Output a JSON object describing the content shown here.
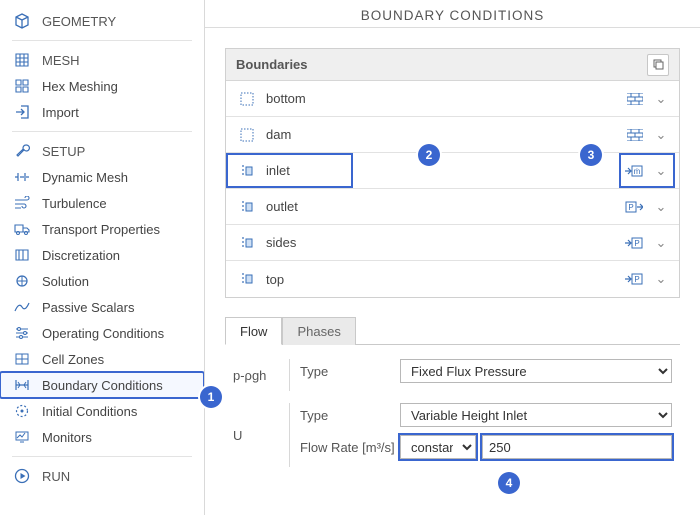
{
  "sidebar": {
    "groups": [
      {
        "head": "GEOMETRY",
        "items": []
      },
      {
        "head": "MESH",
        "items": [
          "Hex Meshing",
          "Import"
        ]
      },
      {
        "head": "SETUP",
        "items": [
          "Dynamic Mesh",
          "Turbulence",
          "Transport Properties",
          "Discretization",
          "Solution",
          "Passive Scalars",
          "Operating Conditions",
          "Cell Zones",
          "Boundary Conditions",
          "Initial Conditions",
          "Monitors"
        ]
      },
      {
        "head": "RUN",
        "items": []
      }
    ]
  },
  "main": {
    "title": "BOUNDARY CONDITIONS",
    "panel_title": "Boundaries",
    "boundaries": [
      {
        "name": "bottom",
        "badge": "wall"
      },
      {
        "name": "dam",
        "badge": "wall"
      },
      {
        "name": "inlet",
        "badge": "m"
      },
      {
        "name": "outlet",
        "badge": "P"
      },
      {
        "name": "sides",
        "badge": "P"
      },
      {
        "name": "top",
        "badge": "P"
      }
    ],
    "tabs": [
      "Flow",
      "Phases"
    ],
    "form": {
      "p_label": "p-ρgh",
      "u_label": "U",
      "type_label": "Type",
      "flowrate_label": "Flow Rate [m³/s]",
      "p_type": "Fixed Flux Pressure",
      "u_type": "Variable Height Inlet",
      "rate_mode": "constant",
      "rate_value": "250"
    }
  },
  "annotations": {
    "b1": "1",
    "b2": "2",
    "b3": "3",
    "b4": "4"
  }
}
